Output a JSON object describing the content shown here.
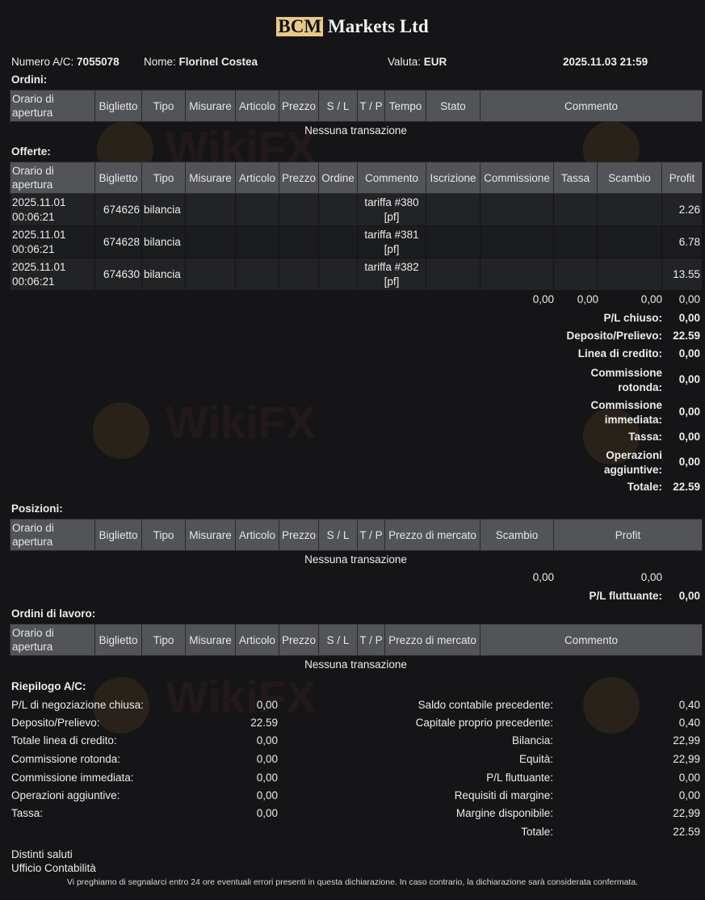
{
  "header": {
    "logo_mark": "BCM",
    "title_rest": "Markets Ltd",
    "account_label": "Numero A/C:",
    "account_value": "7055078",
    "name_label": "Nome:",
    "name_value": "Florinel Costea",
    "currency_label": "Valuta:",
    "currency_value": "EUR",
    "datetime": "2025.11.03 21:59"
  },
  "orders": {
    "title": "Ordini:",
    "headers": [
      "Orario di apertura",
      "Biglietto",
      "Tipo",
      "Misurare",
      "Articolo",
      "Prezzo",
      "S / L",
      "T / P",
      "Tempo",
      "Stato",
      "Commento"
    ],
    "empty": "Nessuna transazione"
  },
  "deals": {
    "title": "Offerte:",
    "headers": [
      "Orario di apertura",
      "Biglietto",
      "Tipo",
      "Misurare",
      "Articolo",
      "Prezzo",
      "Ordine",
      "Commento",
      "Iscrizione",
      "Commissione",
      "Tassa",
      "Scambio",
      "Profit"
    ],
    "rows": [
      {
        "time": "2025.11.01 00:06:21",
        "ticket": "674626",
        "type": "bilancia",
        "comment": "tariffa #380 [pf]",
        "profit": "2.26"
      },
      {
        "time": "2025.11.01 00:06:21",
        "ticket": "674628",
        "type": "bilancia",
        "comment": "tariffa #381 [pf]",
        "profit": "6.78"
      },
      {
        "time": "2025.11.01 00:06:21",
        "ticket": "674630",
        "type": "bilancia",
        "comment": "tariffa #382 [pf]",
        "profit": "13.55"
      }
    ],
    "totals": [
      "0,00",
      "0,00",
      "0,00",
      "0,00"
    ],
    "summary": [
      {
        "label": "P/L chiuso:",
        "value": "0,00"
      },
      {
        "label": "Deposito/Prelievo:",
        "value": "22.59"
      },
      {
        "label": "Linea di credito:",
        "value": "0,00"
      },
      {
        "label": "Commissione rotonda:",
        "value": "0,00"
      },
      {
        "label": "Commissione immediata:",
        "value": "0,00"
      },
      {
        "label": "Tassa:",
        "value": "0,00"
      },
      {
        "label": "Operazioni aggiuntive:",
        "value": "0,00"
      },
      {
        "label": "Totale:",
        "value": "22.59"
      }
    ]
  },
  "positions": {
    "title": "Posizioni:",
    "headers": [
      "Orario di apertura",
      "Biglietto",
      "Tipo",
      "Misurare",
      "Articolo",
      "Prezzo",
      "S / L",
      "T / P",
      "Prezzo di mercato",
      "Scambio",
      "Profit"
    ],
    "empty": "Nessuna transazione",
    "totals": [
      "0,00",
      "0,00"
    ],
    "floating_label": "P/L fluttuante:",
    "floating_value": "0,00"
  },
  "working": {
    "title": "Ordini di lavoro:",
    "headers": [
      "Orario di apertura",
      "Biglietto",
      "Tipo",
      "Misurare",
      "Articolo",
      "Prezzo",
      "S / L",
      "T / P",
      "Prezzo di mercato",
      "Commento"
    ],
    "empty": "Nessuna transazione"
  },
  "summary": {
    "title": "Riepilogo A/C:",
    "left": [
      {
        "label": "P/L di negoziazione chiusa:",
        "value": "0,00"
      },
      {
        "label": "Deposito/Prelievo:",
        "value": "22.59"
      },
      {
        "label": "Totale linea di credito:",
        "value": "0,00"
      },
      {
        "label": "Commissione rotonda:",
        "value": "0,00"
      },
      {
        "label": "Commissione immediata:",
        "value": "0,00"
      },
      {
        "label": "Operazioni aggiuntive:",
        "value": "0,00"
      },
      {
        "label": "Tassa:",
        "value": "0,00"
      }
    ],
    "right": [
      {
        "label": "Saldo contabile precedente:",
        "value": "0,40"
      },
      {
        "label": "Capitale proprio precedente:",
        "value": "0,40"
      },
      {
        "label": "Bilancia:",
        "value": "22,99"
      },
      {
        "label": "Equità:",
        "value": "22,99"
      },
      {
        "label": "P/L fluttuante:",
        "value": "0,00"
      },
      {
        "label": "Requisiti di margine:",
        "value": "0,00"
      },
      {
        "label": "Margine disponibile:",
        "value": "22,99"
      },
      {
        "label": "Totale:",
        "value": "22.59"
      }
    ]
  },
  "closing": {
    "line1": "Distinti saluti",
    "line2": "Ufficio Contabilità",
    "disclaimer": "Vi preghiamo di segnalarci entro 24 ore eventuali errori presenti in questa dichiarazione. In caso contrario, la dichiarazione sarà considerata confermata."
  },
  "watermark": {
    "text": "WikiFX",
    "icon": "eagle-logo-icon"
  }
}
